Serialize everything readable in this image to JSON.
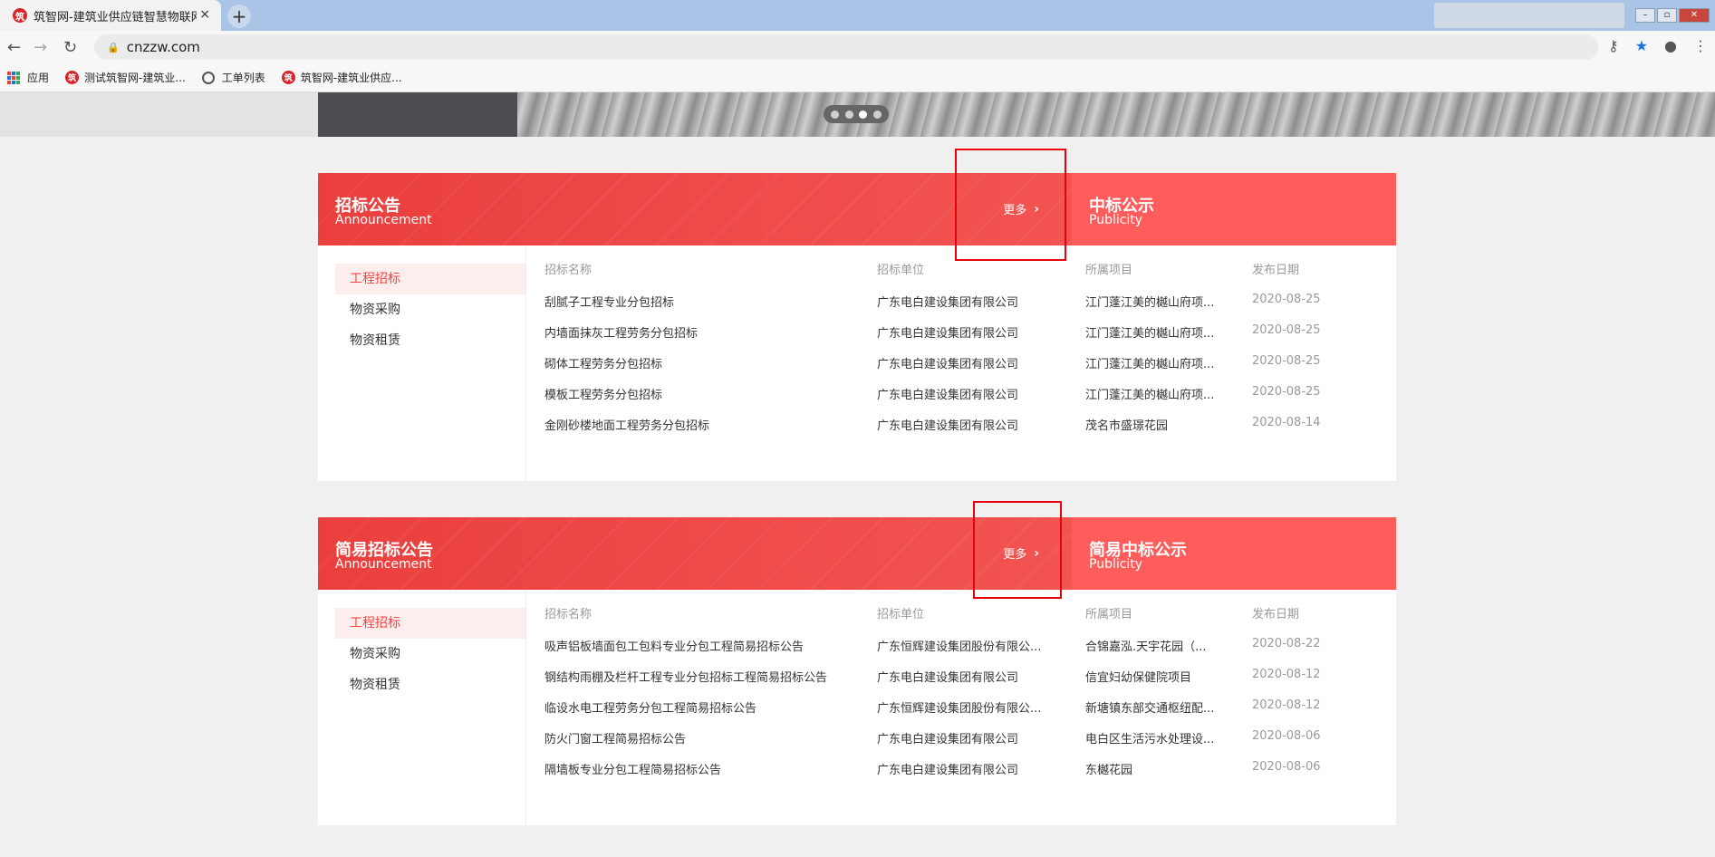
{
  "browser": {
    "tab_title": "筑智网-建筑业供应链智慧物联网",
    "tab_close": "×",
    "new_tab": "+",
    "url": "cnzzw.com",
    "back": "←",
    "forward": "→",
    "reload": "↻",
    "bookmarks": [
      "应用",
      "测试筑智网-建筑业...",
      "工单列表",
      "筑智网-建筑业供应..."
    ]
  },
  "carousel": {
    "dot_count": 4,
    "active_index": 2
  },
  "sections": [
    {
      "title": "招标公告",
      "subtitle": "Announcement",
      "right_title": "中标公示",
      "right_subtitle": "Publicity",
      "more": "更多",
      "side_items": [
        "工程招标",
        "物资采购",
        "物资租赁"
      ],
      "columns": [
        "招标名称",
        "招标单位",
        "所属项目",
        "发布日期"
      ],
      "rows": [
        [
          "刮腻子工程专业分包招标",
          "广东电白建设集团有限公司",
          "江门蓬江美的樾山府项...",
          "2020-08-25"
        ],
        [
          "内墙面抹灰工程劳务分包招标",
          "广东电白建设集团有限公司",
          "江门蓬江美的樾山府项...",
          "2020-08-25"
        ],
        [
          "砌体工程劳务分包招标",
          "广东电白建设集团有限公司",
          "江门蓬江美的樾山府项...",
          "2020-08-25"
        ],
        [
          "模板工程劳务分包招标",
          "广东电白建设集团有限公司",
          "江门蓬江美的樾山府项...",
          "2020-08-25"
        ],
        [
          "金刚砂楼地面工程劳务分包招标",
          "广东电白建设集团有限公司",
          "茂名市盛璟花园",
          "2020-08-14"
        ]
      ]
    },
    {
      "title": "简易招标公告",
      "subtitle": "Announcement",
      "right_title": "简易中标公示",
      "right_subtitle": "Publicity",
      "more": "更多",
      "side_items": [
        "工程招标",
        "物资采购",
        "物资租赁"
      ],
      "columns": [
        "招标名称",
        "招标单位",
        "所属项目",
        "发布日期"
      ],
      "rows": [
        [
          "吸声铝板墙面包工包料专业分包工程简易招标公告",
          "广东恒辉建设集团股份有限公...",
          "合锦嘉泓.天宇花园（...",
          "2020-08-22"
        ],
        [
          "钢结构雨棚及栏杆工程专业分包招标工程简易招标公告",
          "广东电白建设集团有限公司",
          "信宜妇幼保健院项目",
          "2020-08-12"
        ],
        [
          "临设水电工程劳务分包工程简易招标公告",
          "广东恒辉建设集团股份有限公...",
          "新塘镇东部交通枢纽配...",
          "2020-08-12"
        ],
        [
          "防火门窗工程简易招标公告",
          "广东电白建设集团有限公司",
          "电白区生活污水处理设...",
          "2020-08-06"
        ],
        [
          "隔墙板专业分包工程简易招标公告",
          "广东电白建设集团有限公司",
          "东樾花园",
          "2020-08-06"
        ]
      ]
    }
  ],
  "colors": {
    "head_red": "#ee4643",
    "head_right": "#fe5d5b",
    "active_bg": "#fdeeee",
    "box_red": "#e8000b"
  }
}
